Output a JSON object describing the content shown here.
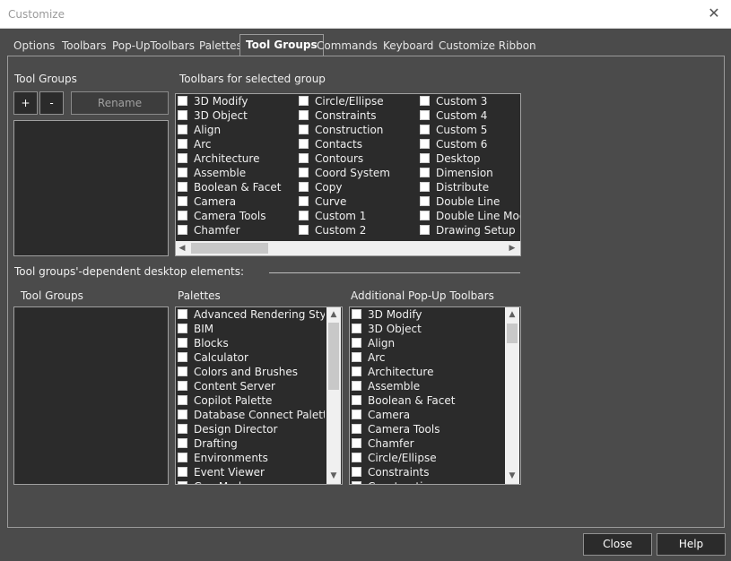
{
  "window": {
    "title": "Customize"
  },
  "tabs": [
    {
      "label": "Options"
    },
    {
      "label": "Toolbars"
    },
    {
      "label": "Pop-UpToolbars"
    },
    {
      "label": "Palettes"
    },
    {
      "label": "Tool Groups"
    },
    {
      "label": "Commands"
    },
    {
      "label": "Keyboard"
    },
    {
      "label": "Customize Ribbon"
    }
  ],
  "groups_section": {
    "label": "Tool Groups",
    "add_label": "+",
    "remove_label": "-",
    "rename_label": "Rename"
  },
  "toolbars_section": {
    "label": "Toolbars for selected group",
    "col1": [
      "3D Modify",
      "3D Object",
      "Align",
      "Arc",
      "Architecture",
      "Assemble",
      "Boolean & Facet",
      "Camera",
      "Camera Tools",
      "Chamfer"
    ],
    "col2": [
      "Circle/Ellipse",
      "Constraints",
      "Construction",
      "Contacts",
      "Contours",
      "Coord System",
      "Copy",
      "Curve",
      "Custom 1",
      "Custom 2"
    ],
    "col3": [
      "Custom 3",
      "Custom 4",
      "Custom 5",
      "Custom 6",
      "Desktop",
      "Dimension",
      "Distribute",
      "Double Line",
      "Double Line Modi",
      "Drawing Setup"
    ]
  },
  "dependent_label": "Tool groups'-dependent desktop elements:",
  "tool_groups_label2": "Tool Groups",
  "palettes": {
    "label": "Palettes",
    "items": [
      "Advanced Rendering Styles",
      "BIM",
      "Blocks",
      "Calculator",
      "Colors and Brushes",
      "Content Server",
      "Copilot Palette",
      "Database Connect Palette",
      "Design Director",
      "Drafting",
      "Environments",
      "Event Viewer",
      "Geo Mod"
    ]
  },
  "popups": {
    "label": "Additional Pop-Up Toolbars",
    "items": [
      "3D Modify",
      "3D Object",
      "Align",
      "Arc",
      "Architecture",
      "Assemble",
      "Boolean & Facet",
      "Camera",
      "Camera Tools",
      "Chamfer",
      "Circle/Ellipse",
      "Constraints",
      "Construction"
    ]
  },
  "footer": {
    "close_label": "Close",
    "help_label": "Help"
  }
}
